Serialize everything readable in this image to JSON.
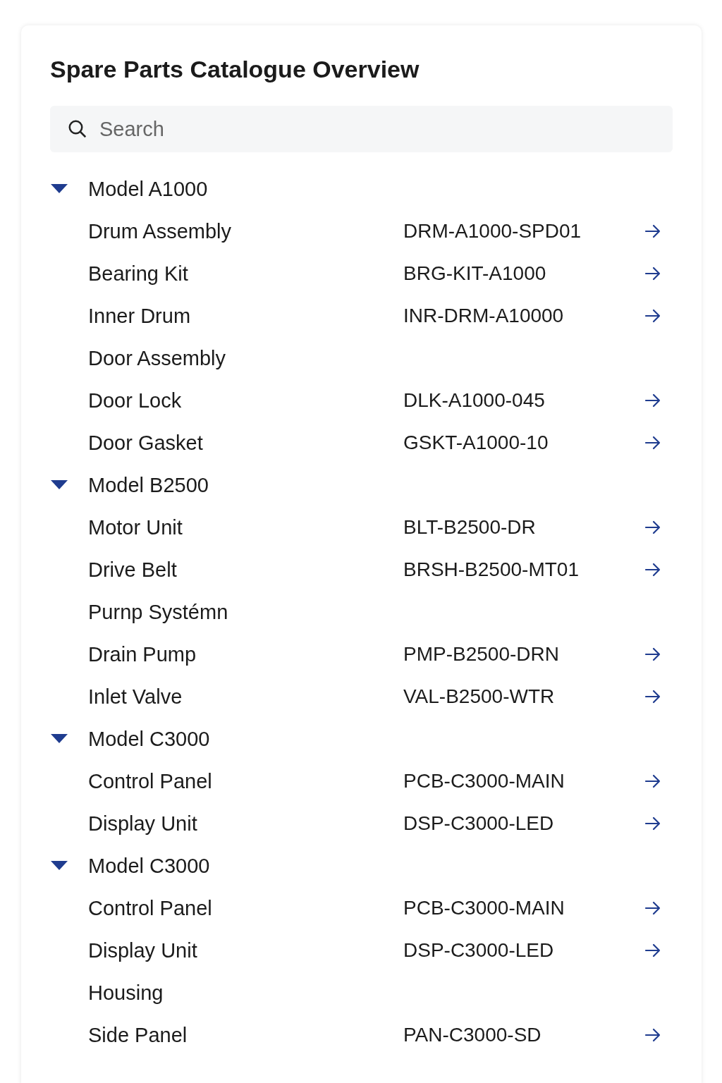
{
  "title": "Spare Parts Catalogue Overview",
  "search": {
    "placeholder": "Search"
  },
  "models": [
    {
      "name": "Model A1000",
      "expanded": true,
      "items": [
        {
          "kind": "part",
          "name": "Drum Assembly",
          "part_number": "DRM-A1000-SPD01"
        },
        {
          "kind": "part",
          "name": "Bearing Kit",
          "part_number": "BRG-KIT-A1000"
        },
        {
          "kind": "part",
          "name": "Inner Drum",
          "part_number": "INR-DRM-A10000"
        },
        {
          "kind": "group",
          "name": "Door Assembly"
        },
        {
          "kind": "part",
          "name": "Door Lock",
          "part_number": "DLK-A1000-045"
        },
        {
          "kind": "part",
          "name": "Door Gasket",
          "part_number": "GSKT-A1000-10"
        }
      ]
    },
    {
      "name": "Model B2500",
      "expanded": true,
      "items": [
        {
          "kind": "part",
          "name": "Motor Unit",
          "part_number": "BLT-B2500-DR"
        },
        {
          "kind": "part",
          "name": "Drive Belt",
          "part_number": "BRSH-B2500-MT01"
        },
        {
          "kind": "group",
          "name": "Purnp Systémn"
        },
        {
          "kind": "part",
          "name": "Drain Pump",
          "part_number": "PMP-B2500-DRN"
        },
        {
          "kind": "part",
          "name": "Inlet Valve",
          "part_number": "VAL-B2500-WTR"
        }
      ]
    },
    {
      "name": "Model C3000",
      "expanded": true,
      "items": [
        {
          "kind": "part",
          "name": "Control Panel",
          "part_number": "PCB-C3000-MAIN"
        },
        {
          "kind": "part",
          "name": "Display Unit",
          "part_number": "DSP-C3000-LED"
        }
      ]
    },
    {
      "name": "Model C3000",
      "expanded": true,
      "items": [
        {
          "kind": "part",
          "name": "Control Panel",
          "part_number": "PCB-C3000-MAIN"
        },
        {
          "kind": "part",
          "name": "Display Unit",
          "part_number": "DSP-C3000-LED"
        },
        {
          "kind": "group",
          "name": "Housing"
        },
        {
          "kind": "part",
          "name": "Side Panel",
          "part_number": "PAN-C3000-SD"
        }
      ]
    }
  ]
}
